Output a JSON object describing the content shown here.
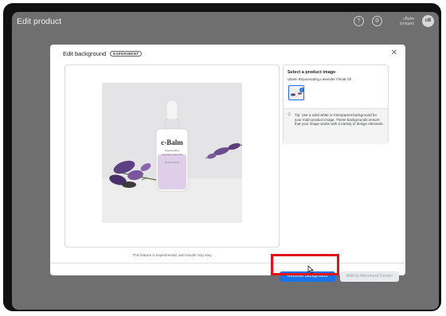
{
  "app": {
    "title": "Edit product",
    "account_line1": "cBalm",
    "account_line2": "(unique)",
    "avatar_initials": "cB",
    "help_icon": "help-circle-icon",
    "settings_icon": "gear-icon"
  },
  "modal": {
    "title": "Edit background",
    "badge": "EXPERIMENT",
    "close_icon": "close-icon",
    "disclaimer": "This feature is experimental, and results may vary",
    "preview": {
      "brand": "c-Balm",
      "label_line1": "Rejuvenating",
      "label_line2": "Lavender Facial Oil",
      "volume": "30 ml / 1.0 fl oz"
    },
    "panel": {
      "title": "Select a product image",
      "product_name": "cBalm Rejuvenating Lavender Facial Oil",
      "tip_icon": "lightbulb-icon",
      "tip": "Tip: Use a solid white or transparent background for your main product image. These backgrounds ensure that your image works with a variety of design elements."
    },
    "buttons": {
      "remove_background": "Remove background",
      "add_to_merchant_center": "Add to Merchant Center"
    }
  },
  "colors": {
    "primary": "#1a73e8",
    "highlight": "#e0141b",
    "backdrop": "#6f6f6f"
  }
}
